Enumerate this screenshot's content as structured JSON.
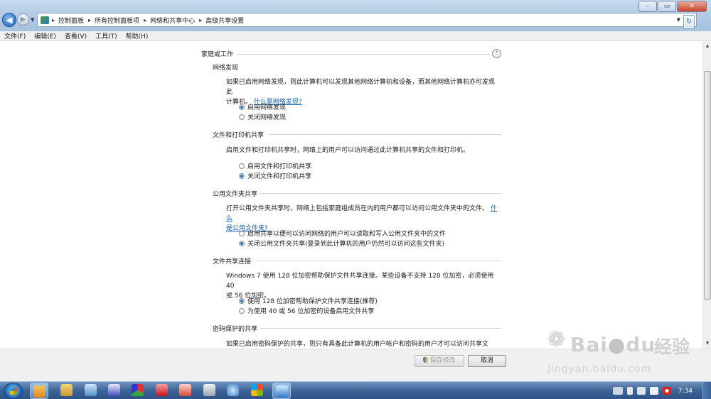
{
  "window": {
    "min_label": "–",
    "max_label": "▭",
    "close_label": "✕"
  },
  "nav": {
    "back_glyph": "◀",
    "forward_glyph": "▶",
    "breadcrumbs": [
      "控制面板",
      "所有控制面板项",
      "网络和共享中心",
      "高级共享设置"
    ],
    "refresh_glyph": "↻"
  },
  "menu": {
    "items": [
      "文件(F)",
      "编辑(E)",
      "查看(V)",
      "工具(T)",
      "帮助(H)"
    ]
  },
  "profile": {
    "title": "家庭或工作",
    "collapse_glyph": "⌃"
  },
  "sections": {
    "discovery": {
      "title": "网络发现",
      "desc_line1": "如果已启用网络发现，则此计算机可以发现其他网络计算机和设备，而其他网络计算机亦可发现此",
      "desc_line2": "计算机。",
      "link": "什么是网络发现?",
      "opt_on": "启用网络发现",
      "opt_off": "关闭网络发现"
    },
    "fileprint": {
      "title": "文件和打印机共享",
      "desc": "启用文件和打印机共享时，网络上的用户可以访问通过此计算机共享的文件和打印机。",
      "opt_on": "启用文件和打印机共享",
      "opt_off": "关闭文件和打印机共享"
    },
    "public": {
      "title": "公用文件夹共享",
      "desc": "打开公用文件夹共享时，网络上包括家庭组成员在内的用户都可以访问公用文件夹中的文件。",
      "link_part1": "什么",
      "link_part2": "是公用文件夹?",
      "opt_on": "启用共享以便可以访问网络的用户可以读取和写入公用文件夹中的文件",
      "opt_off": "关闭公用文件夹共享(登录到此计算机的用户仍然可以访问这些文件夹)"
    },
    "connections": {
      "title": "文件共享连接",
      "desc_line1": "Windows 7 使用 128 位加密帮助保护文件共享连接。某些设备不支持 128 位加密，必须使用 40",
      "desc_line2": "或 56 位加密。",
      "opt_128": "使用 128 位加密帮助保护文件共享连接(推荐)",
      "opt_40": "为使用 40 或 56 位加密的设备启用文件共享"
    },
    "password": {
      "title": "密码保护的共享",
      "desc": "如果已启用密码保护的共享，则只有具备此计算机的用户帐户和密码的用户才可以访问共享文件、"
    }
  },
  "buttons": {
    "save": "保存修改",
    "cancel": "取消"
  },
  "watermark": {
    "brand": "Bai",
    "brand2": "du",
    "jingyan": "经验",
    "url": "jingyan.baidu.com"
  },
  "taskbar": {
    "time": "7:34"
  }
}
